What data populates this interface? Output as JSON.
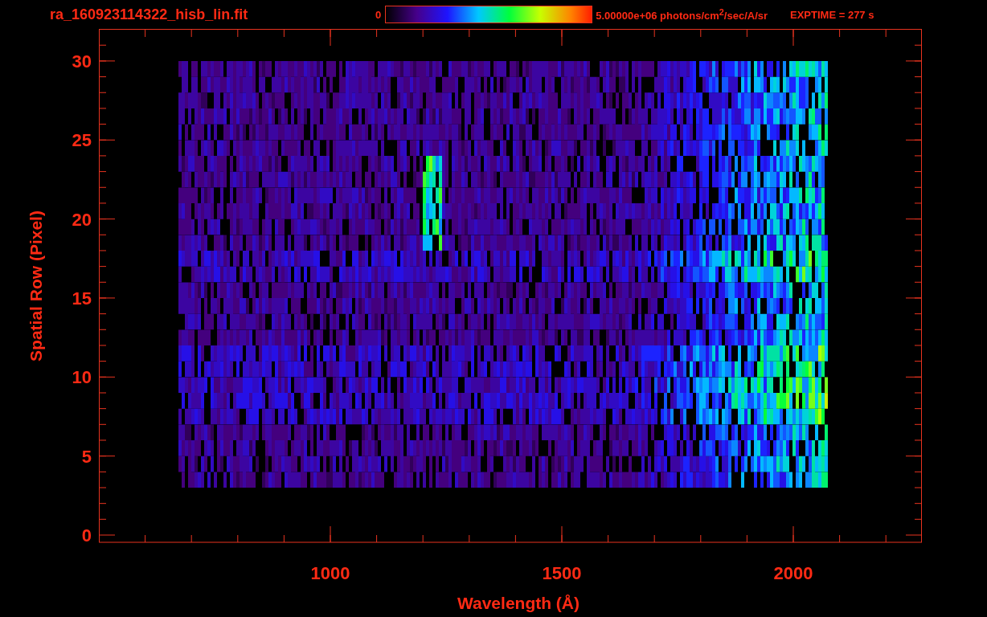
{
  "header": {
    "file_name": "ra_160923114322_hisb_lin.fit",
    "colorbar": {
      "min_label": "0",
      "max_label": "5.00000e+06 photons/cm$^{2}$/sec/A/sr"
    },
    "exposure": "EXPTIME = 277 s"
  },
  "plot": {
    "y_axis": {
      "label": "Spatial Row (Pixel)",
      "ticks": [
        "30",
        "25",
        "20",
        "15",
        "10",
        "5",
        "0"
      ]
    },
    "x_axis": {
      "label": "Wavelength (Å)",
      "ticks": [
        "1000",
        "1500",
        "2000"
      ]
    }
  }
}
